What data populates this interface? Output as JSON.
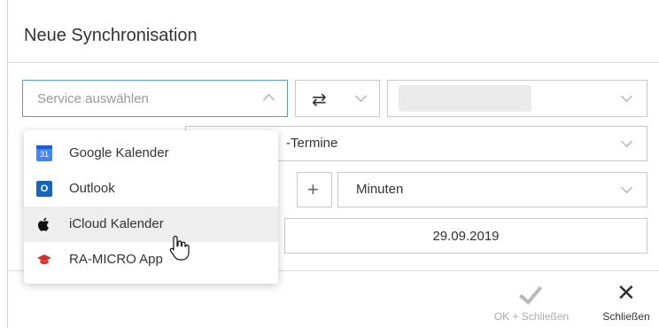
{
  "dialog": {
    "title": "Neue Synchronisation"
  },
  "service": {
    "placeholder": "Service auswählen"
  },
  "direction": {
    "icon": "swap-arrows-icon",
    "glyph": "⇄"
  },
  "type_field": {
    "value": "-Termine"
  },
  "interval": {
    "plus_glyph": "+",
    "unit": "Minuten"
  },
  "date_field": {
    "value": "29.09.2019"
  },
  "dropdown": {
    "options": [
      {
        "label": "Google Kalender",
        "icon": "google-calendar-icon",
        "icon_text": "31"
      },
      {
        "label": "Outlook",
        "icon": "outlook-icon",
        "icon_text": "O"
      },
      {
        "label": "iCloud Kalender",
        "icon": "apple-icon",
        "icon_text": ""
      },
      {
        "label": "RA-MICRO App",
        "icon": "ra-micro-icon",
        "icon_text": "🎓"
      }
    ],
    "hovered_index": 2
  },
  "footer": {
    "ok_label": "OK + Schließen",
    "close_label": "Schließen",
    "close_glyph": "✕"
  },
  "colors": {
    "focus_border": "#5b9bd5",
    "hover_bg": "#eeeeee",
    "disabled_text": "#aaaaaa"
  }
}
